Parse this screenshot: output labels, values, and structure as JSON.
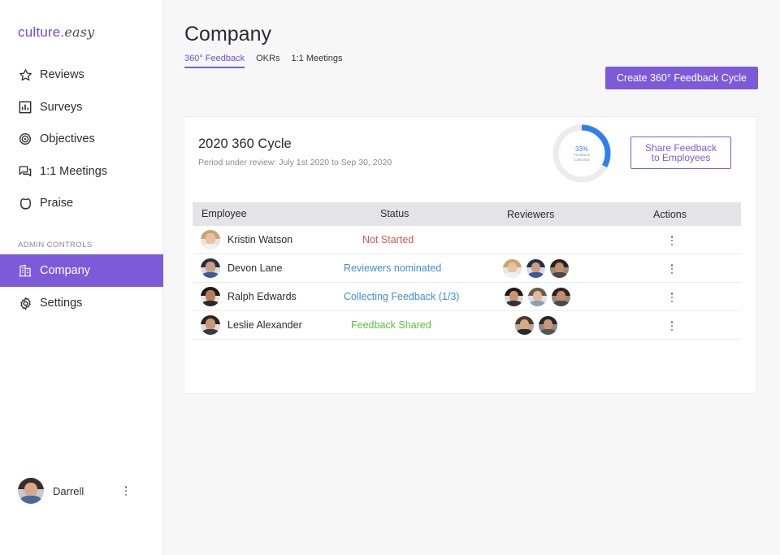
{
  "app": {
    "logo_main": "culture.",
    "logo_accent": "easy"
  },
  "sidebar": {
    "items": [
      {
        "label": "Reviews",
        "icon": "star-icon"
      },
      {
        "label": "Surveys",
        "icon": "bar-chart-icon"
      },
      {
        "label": "Objectives",
        "icon": "target-icon"
      },
      {
        "label": "1:1 Meetings",
        "icon": "chat-icon"
      },
      {
        "label": "Praise",
        "icon": "praise-icon"
      }
    ],
    "admin_label": "ADMIN CONTROLS",
    "admin_items": [
      {
        "label": "Company",
        "icon": "building-icon",
        "active": true
      },
      {
        "label": "Settings",
        "icon": "gear-icon"
      }
    ],
    "user": {
      "name": "Darrell"
    }
  },
  "header": {
    "title": "Company",
    "tabs": [
      {
        "label": "360° Feedback",
        "active": true
      },
      {
        "label": "OKRs"
      },
      {
        "label": "1:1 Meetings"
      }
    ],
    "create_button": "Create 360° Feedback Cycle"
  },
  "cycle": {
    "title": "2020 360 Cycle",
    "period": "Period under review: July 1st 2020 to Sep 30, 2020",
    "progress": {
      "percent_label": "33%",
      "caption": "Feedback Collected",
      "fraction": 0.33
    },
    "share_button_line1": "Share Feedback",
    "share_button_line2": "to Employees"
  },
  "table": {
    "headers": {
      "employee": "Employee",
      "status": "Status",
      "reviewers": "Reviewers",
      "actions": "Actions"
    },
    "rows": [
      {
        "name": "Kristin Watson",
        "status": "Not Started"
      },
      {
        "name": "Devon Lane",
        "status": "Reviewers nominated"
      },
      {
        "name": "Ralph Edwards",
        "status": "Collecting Feedback (1/3)"
      },
      {
        "name": "Leslie Alexander",
        "status": "Feedback Shared"
      }
    ]
  },
  "colors": {
    "accent": "#7d5bd8",
    "not_started": "#e55353",
    "in_progress": "#3d8fd8",
    "shared": "#5cbf3a",
    "progress_ring": "#2f80ed"
  }
}
